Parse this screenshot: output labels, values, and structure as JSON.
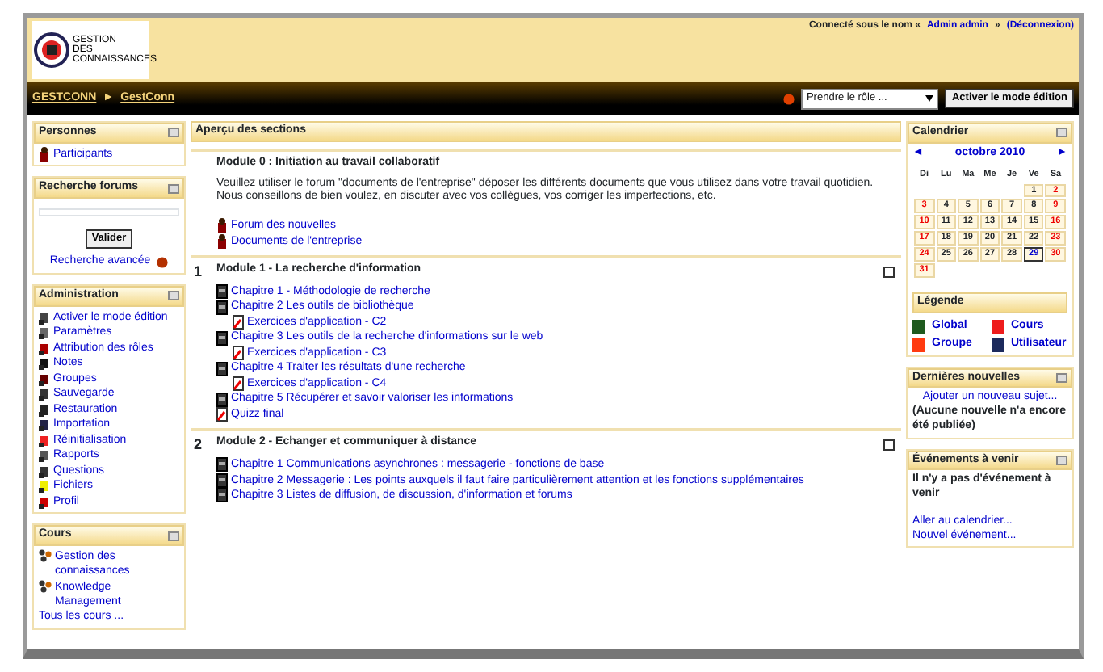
{
  "header": {
    "logo_lines": [
      "GESTION",
      "DES",
      "CONNAISSANCES"
    ],
    "login_text": "Connecté sous le nom «",
    "user_link": "Admin admin",
    "login_mid": "»",
    "logout_link": "(Déconnexion)"
  },
  "navbar": {
    "breadcrumb": [
      "GESTCONN",
      "GestConn"
    ],
    "separator": "►",
    "role_select": "Prendre le rôle ...",
    "edit_button": "Activer le mode édition"
  },
  "left_blocks": [
    {
      "kind": "links",
      "title": "Personnes",
      "items": [
        {
          "label": "Participants"
        }
      ]
    },
    {
      "kind": "search",
      "title": "Recherche forums",
      "button": "Valider",
      "link": "Recherche avancée"
    },
    {
      "kind": "links",
      "title": "Administration",
      "items": [
        {
          "label": "Activer le mode édition"
        },
        {
          "label": "Paramètres"
        },
        {
          "label": "Attribution des rôles"
        },
        {
          "label": "Notes"
        },
        {
          "label": "Groupes"
        },
        {
          "label": "Sauvegarde"
        },
        {
          "label": "Restauration"
        },
        {
          "label": "Importation"
        },
        {
          "label": "Réinitialisation"
        },
        {
          "label": "Rapports"
        },
        {
          "label": "Questions"
        },
        {
          "label": "Fichiers"
        },
        {
          "label": "Profil"
        }
      ]
    },
    {
      "kind": "courses",
      "title": "Cours",
      "items": [
        {
          "label": "Gestion des connaissances"
        },
        {
          "label": "Knowledge Management"
        }
      ],
      "all_link": "Tous les cours ..."
    }
  ],
  "sections_header": "Aperçu des sections",
  "sections": [
    {
      "title": "Module 0 : Initiation au travail collaboratif",
      "summary": "Veuillez utiliser le forum \"documents de l'entreprise\" déposer les différents documents que vous utilisez dans votre travail quotidien. Nous conseillons de bien voulez, en discuter avec vos collègues, vos corriger les imperfections, etc.",
      "items": [
        {
          "kind": "forum",
          "label": "Forum des nouvelles",
          "indent": false
        },
        {
          "kind": "forum",
          "label": "Documents de l'entreprise",
          "indent": false
        }
      ]
    },
    {
      "number": "1",
      "title": "Module 1 - La recherche d'information",
      "items": [
        {
          "kind": "book",
          "label": "Chapitre 1 - Méthodologie de recherche",
          "indent": false
        },
        {
          "kind": "book",
          "label": "Chapitre 2 Les outils de bibliothèque",
          "indent": false
        },
        {
          "kind": "quiz",
          "label": "Exercices d'application - C2",
          "indent": true
        },
        {
          "kind": "book",
          "label": "Chapitre 3 Les outils de la recherche d'informations sur le web",
          "indent": false
        },
        {
          "kind": "quiz",
          "label": "Exercices d'application - C3",
          "indent": true
        },
        {
          "kind": "book",
          "label": "Chapitre 4 Traiter les résultats d'une recherche",
          "indent": false
        },
        {
          "kind": "quiz",
          "label": "Exercices d'application - C4",
          "indent": true
        },
        {
          "kind": "book",
          "label": "Chapitre 5 Récupérer et savoir valoriser les informations",
          "indent": false
        },
        {
          "kind": "quiz",
          "label": "Quizz final",
          "indent": false
        }
      ]
    },
    {
      "number": "2",
      "title": "Module 2 - Echanger et communiquer à distance",
      "items": [
        {
          "kind": "book",
          "label": "Chapitre 1 Communications asynchrones : messagerie - fonctions de base",
          "indent": false
        },
        {
          "kind": "book",
          "label": "Chapitre 2 Messagerie : Les points auxquels il faut faire particulièrement attention et les fonctions supplémentaires",
          "indent": false
        },
        {
          "kind": "book",
          "label": "Chapitre 3 Listes de diffusion, de discussion, d'information et forums",
          "indent": false
        }
      ]
    }
  ],
  "calendar": {
    "title": "Calendrier",
    "prev": "◄",
    "month": "octobre 2010",
    "next": "►",
    "weekdays": [
      "Di",
      "Lu",
      "Ma",
      "Me",
      "Je",
      "Ve",
      "Sa"
    ],
    "weeks": [
      [
        {
          "day": "1",
          "today": false
        },
        {
          "day": "2",
          "today": false
        }
      ],
      [
        {
          "day": "3",
          "today": false
        },
        {
          "day": "4",
          "today": false
        },
        {
          "day": "5",
          "today": false
        },
        {
          "day": "6",
          "today": false
        },
        {
          "day": "7",
          "today": false
        },
        {
          "day": "8",
          "today": false
        },
        {
          "day": "9",
          "today": false
        }
      ],
      [
        {
          "day": "10",
          "today": false
        },
        {
          "day": "11",
          "today": false
        },
        {
          "day": "12",
          "today": false
        },
        {
          "day": "13",
          "today": false
        },
        {
          "day": "14",
          "today": false
        },
        {
          "day": "15",
          "today": false
        },
        {
          "day": "16",
          "today": false
        }
      ],
      [
        {
          "day": "17",
          "today": false
        },
        {
          "day": "18",
          "today": false
        },
        {
          "day": "19",
          "today": false
        },
        {
          "day": "20",
          "today": false
        },
        {
          "day": "21",
          "today": false
        },
        {
          "day": "22",
          "today": false
        },
        {
          "day": "23",
          "today": false
        }
      ],
      [
        {
          "day": "24",
          "today": false
        },
        {
          "day": "25",
          "today": false
        },
        {
          "day": "26",
          "today": false
        },
        {
          "day": "27",
          "today": false
        },
        {
          "day": "28",
          "today": false
        },
        {
          "day": "29",
          "today": true
        },
        {
          "day": "30",
          "today": false
        }
      ],
      [
        {
          "day": "31",
          "today": false
        }
      ]
    ],
    "legend_title": "Légende",
    "legend": [
      {
        "label": "Global",
        "color": "#1f5a1f"
      },
      {
        "label": "Cours",
        "color": "#ee1c1c"
      },
      {
        "label": "Groupe",
        "color": "#ff3b10"
      },
      {
        "label": "Utilisateur",
        "color": "#1c2a5c"
      }
    ]
  },
  "news": {
    "title": "Dernières nouvelles",
    "add_link": "Ajouter un nouveau sujet...",
    "empty": "(Aucune nouvelle n'a encore été publiée)"
  },
  "events": {
    "title": "Événements à venir",
    "empty": "Il n'y a pas d'événement à venir",
    "links": [
      "Aller au calendrier...",
      "Nouvel événement..."
    ]
  }
}
